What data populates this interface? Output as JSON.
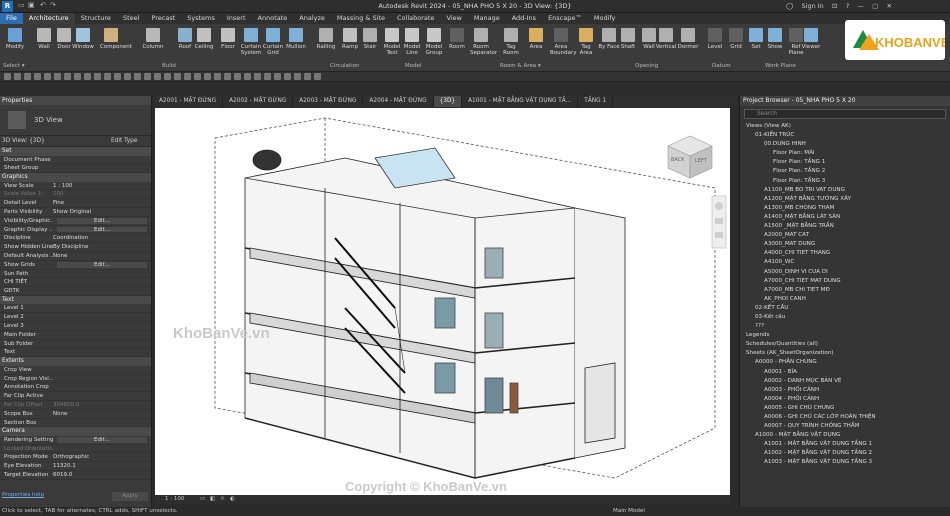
{
  "app": {
    "title": "Autodesk Revit 2024 - 05_NHA PHO 5 X 20 - 3D View: {3D}",
    "sign_in": "Sign In"
  },
  "ribbon_tabs": [
    "File",
    "Architecture",
    "Structure",
    "Steel",
    "Precast",
    "Systems",
    "Insert",
    "Annotate",
    "Analyze",
    "Massing & Site",
    "Collaborate",
    "View",
    "Manage",
    "Add-Ins",
    "Enscape™",
    "Modify"
  ],
  "ribbon_buttons": [
    "Modify",
    "Wall",
    "Door",
    "Window",
    "Component",
    "Column",
    "Roof",
    "Ceiling",
    "Floor",
    "Curtain System",
    "Curtain Grid",
    "Mullion",
    "Railing",
    "Ramp",
    "Stair",
    "Model Text",
    "Model Line",
    "Model Group",
    "Room",
    "Room Separator",
    "Tag Room",
    "Area",
    "Area Boundary",
    "Tag Area",
    "By Face",
    "Shaft",
    "Wall",
    "Vertical",
    "Dormer",
    "Level",
    "Grid",
    "Set",
    "Show",
    "Ref Plane",
    "Viewer"
  ],
  "ribbon_groups": [
    "Select ▾",
    "Build",
    "Circulation",
    "Model",
    "Room & Area ▾",
    "Opening",
    "Datum",
    "Work Plane"
  ],
  "properties": {
    "header": "Properties",
    "type_name": "3D View",
    "selector": "3D View: {3D}",
    "edit_type": "Edit Type",
    "apply": "Apply",
    "help_link": "Properties help",
    "sections": [
      {
        "name": "Set",
        "rows": [
          [
            "Document Phase",
            ""
          ],
          [
            "Sheet Group",
            ""
          ]
        ]
      },
      {
        "name": "Graphics",
        "rows": [
          [
            "View Scale",
            "1 : 100"
          ],
          [
            "Scale Value 1:",
            "100"
          ],
          [
            "Detail Level",
            "Fine"
          ],
          [
            "Parts Visibility",
            "Show Original"
          ],
          [
            "Visibility/Graphic...",
            "Edit..."
          ],
          [
            "Graphic Display ...",
            "Edit..."
          ],
          [
            "Discipline",
            "Coordination"
          ],
          [
            "Show Hidden Lines",
            "By Discipline"
          ],
          [
            "Default Analysis ...",
            "None"
          ],
          [
            "Show Grids",
            "Edit..."
          ],
          [
            "Sun Path",
            ""
          ],
          [
            "CHI TIẾT",
            ""
          ],
          [
            "GĐTK",
            ""
          ]
        ]
      },
      {
        "name": "Text",
        "rows": [
          [
            "Level 1",
            ""
          ],
          [
            "Level 2",
            ""
          ],
          [
            "Level 3",
            ""
          ],
          [
            "Main Folder",
            ""
          ],
          [
            "Sub Folder",
            ""
          ],
          [
            "Text",
            ""
          ]
        ]
      },
      {
        "name": "Extents",
        "rows": [
          [
            "Crop View",
            ""
          ],
          [
            "Crop Region Visi...",
            ""
          ],
          [
            "Annotation Crop",
            ""
          ],
          [
            "Far Clip Active",
            ""
          ],
          [
            "Far Clip Offset",
            "304800.0"
          ],
          [
            "Scope Box",
            "None"
          ],
          [
            "Section Box",
            ""
          ]
        ]
      },
      {
        "name": "Camera",
        "rows": [
          [
            "Rendering Settings",
            "Edit..."
          ],
          [
            "Locked Orientation",
            ""
          ],
          [
            "Projection Mode",
            "Orthographic"
          ],
          [
            "Eye Elevation",
            "11320.1"
          ],
          [
            "Target Elevation",
            "6019.0"
          ]
        ]
      }
    ]
  },
  "view_tabs": [
    "A2001 - MẶT ĐỨNG",
    "A2002 - MẶT ĐỨNG",
    "A2003 - MẶT ĐỨNG",
    "A2004 - MẶT ĐỨNG",
    "{3D}",
    "A1001 - MẶT BẰNG VẬT DỤNG TẦ...",
    "TẦNG 1"
  ],
  "view_bar": {
    "scale": "1 : 100",
    "model": "Main Model"
  },
  "project_browser": {
    "header": "Project Browser - 05_NHA PHO 5 X 20",
    "search_placeholder": "Search",
    "items": [
      {
        "t": "Views (View AK)",
        "d": 0
      },
      {
        "t": "01-KIẾN TRÚC",
        "d": 1
      },
      {
        "t": "00.DUNG HINH",
        "d": 2
      },
      {
        "t": "Floor Plan: MÁI",
        "d": 3
      },
      {
        "t": "Floor Plan: TẦNG 1",
        "d": 3
      },
      {
        "t": "Floor Plan: TẦNG 2",
        "d": 3
      },
      {
        "t": "Floor Plan: TẦNG 3",
        "d": 3
      },
      {
        "t": "A1100_MB BO TRI VAT DUNG",
        "d": 2
      },
      {
        "t": "A1200_MẶT BẰNG TƯỜNG XÂY",
        "d": 2
      },
      {
        "t": "A1300_MB CHONG THAM",
        "d": 2
      },
      {
        "t": "A1400_MẶT BẰNG LÁT SÀN",
        "d": 2
      },
      {
        "t": "A1500 _MẶT BẰNG TRẦN",
        "d": 2
      },
      {
        "t": "A2000_MAT CAT",
        "d": 2
      },
      {
        "t": "A3000_MAT DUNG",
        "d": 2
      },
      {
        "t": "A4000_CHI TIET THANG",
        "d": 2
      },
      {
        "t": "A4100_WC",
        "d": 2
      },
      {
        "t": "A5000_DINH VI CUA DI",
        "d": 2
      },
      {
        "t": "A7000_CHI TIET MAT DUNG",
        "d": 2
      },
      {
        "t": "A7000_MB CHI TIET MĐ",
        "d": 2
      },
      {
        "t": "AK_PHOI CANH",
        "d": 2
      },
      {
        "t": "02-KẾT CẤU",
        "d": 1
      },
      {
        "t": "03-Kết cấu",
        "d": 1
      },
      {
        "t": "???",
        "d": 1
      },
      {
        "t": "Legends",
        "d": 0
      },
      {
        "t": "Schedules/Quantities (all)",
        "d": 0
      },
      {
        "t": "Sheets (AK_SheetOrganization)",
        "d": 0
      },
      {
        "t": "A0000 - PHẦN CHUNG",
        "d": 1
      },
      {
        "t": "A0001 - BÌA",
        "d": 2
      },
      {
        "t": "A0002 - DANH MỤC BẢN VẼ",
        "d": 2
      },
      {
        "t": "A0003 - PHỐI CẢNH",
        "d": 2
      },
      {
        "t": "A0004 - PHỐI CẢNH",
        "d": 2
      },
      {
        "t": "A0005 - GHI CHÚ CHUNG",
        "d": 2
      },
      {
        "t": "A0006 - GHI CHÚ CÁC LỚP HOÀN THIỆN",
        "d": 2
      },
      {
        "t": "A0007 - QUY TRÌNH CHỐNG THẤM",
        "d": 2
      },
      {
        "t": "A1000 - MẶT BẰNG VẬT DỤNG",
        "d": 1
      },
      {
        "t": "A1001 - MẶT BẰNG VẬT DỤNG TẦNG 1",
        "d": 2
      },
      {
        "t": "A1002 - MẶT BẰNG VẬT DỤNG TẦNG 2",
        "d": 2
      },
      {
        "t": "A1003 - MẶT BẰNG VẬT DỤNG TẦNG 3",
        "d": 2
      }
    ]
  },
  "viewcube": {
    "front": "BACK",
    "side": "LEFT"
  },
  "status": "Click to select, TAB for alternates, CTRL adds, SHIFT unselects.",
  "status_model": "Main Model",
  "watermarks": {
    "logo": "KHOBANVE",
    "text1": "KhoBanVe.vn",
    "text2": "Copyright © KhoBanVe.vn"
  }
}
